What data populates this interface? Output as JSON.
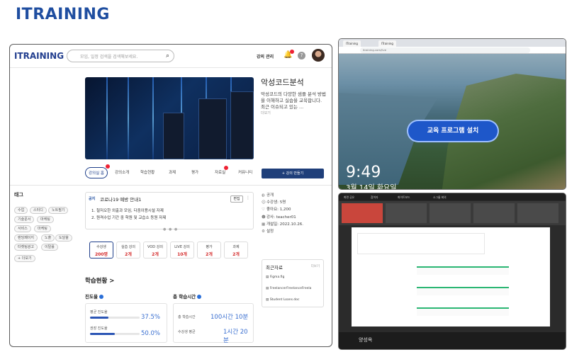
{
  "brand": {
    "name": "ITRAINING"
  },
  "app": {
    "logo": "ITRAINING",
    "search_placeholder": "모임, 일정 검색을 검색해보세요.",
    "manage_label": "강의 관리",
    "help_label": "?"
  },
  "hero": {
    "title": "악성코드분석",
    "description": "악성코드의 다양한 샘플 분석 방법을 이해하고 실습을 교육합니다. 최근 이슈되고 있는 ...",
    "more": "더보기"
  },
  "tabs": [
    {
      "label": "강의실 홈"
    },
    {
      "label": "강의소개"
    },
    {
      "label": "학습현황"
    },
    {
      "label": "과제"
    },
    {
      "label": "평가"
    },
    {
      "label": "자료실"
    },
    {
      "label": "커뮤니티"
    }
  ],
  "create_button": "+ 강의 만들기",
  "tags": {
    "heading": "태그",
    "items": [
      "수업",
      "스터디",
      "노트필기",
      "기술문서",
      "마케팅",
      "서비스",
      "마케팅",
      "랜딩페이지",
      "노출",
      "도달율",
      "타켓팅광고",
      "이탈률"
    ],
    "more": "+ 더보기"
  },
  "notice": {
    "badge": "공지",
    "title": "코로나19 예방 안내1",
    "edit": "편집",
    "more": "⋮",
    "lines": [
      "1. 철저오한 외출과 모임, 다중이용시설 자제",
      "2. 원격수업 기간 중 학원 및 교습소 등원 자제"
    ]
  },
  "stats": [
    {
      "label": "수강생",
      "value": "200명"
    },
    {
      "label": "실습 강의",
      "value": "2개"
    },
    {
      "label": "VOD 강의",
      "value": "2개"
    },
    {
      "label": "LIVE 강의",
      "value": "10개"
    },
    {
      "label": "평가",
      "value": "2개"
    },
    {
      "label": "과제",
      "value": "2개"
    }
  ],
  "info": {
    "public": "공개",
    "students": "수강생: 5명",
    "likes": "좋아요: 1,200",
    "teacher": "강사: teacher01",
    "opened": "개설일: 2022.10.26.",
    "settings": "설정"
  },
  "recent": {
    "title": "최근자료",
    "more": "더보기",
    "files": [
      "Figma.fig",
      "FreelancerFreelanceFreela",
      "Student Loans.doc"
    ]
  },
  "progress": {
    "heading": "학습현황 >",
    "rate_title": "진도율",
    "time_title": "총 학습시간",
    "avg_rate_label": "평균 진도율",
    "avg_rate_value": "37.5%",
    "avg_rate_fill": 0.375,
    "rec_rate_label": "권장 진도율",
    "rec_rate_value": "50.0%",
    "rec_rate_fill": 0.5,
    "total_time_label": "총 학습시간",
    "total_time_value": "100시간 10분",
    "avg_time_label": "수강생 평균",
    "avg_time_value": "1시간 20분"
  },
  "desktop": {
    "install": "교육 프로그램 설치",
    "time": "9:49",
    "date": "3월 14일 화요일",
    "tab1": "ITraining",
    "tab2": "ITraining",
    "url": "itraining.com/live"
  },
  "meeting": {
    "name": "양성옥",
    "tabs": [
      "화면 공유",
      "참여자",
      "화이트보드",
      "소그룹 회의"
    ]
  }
}
